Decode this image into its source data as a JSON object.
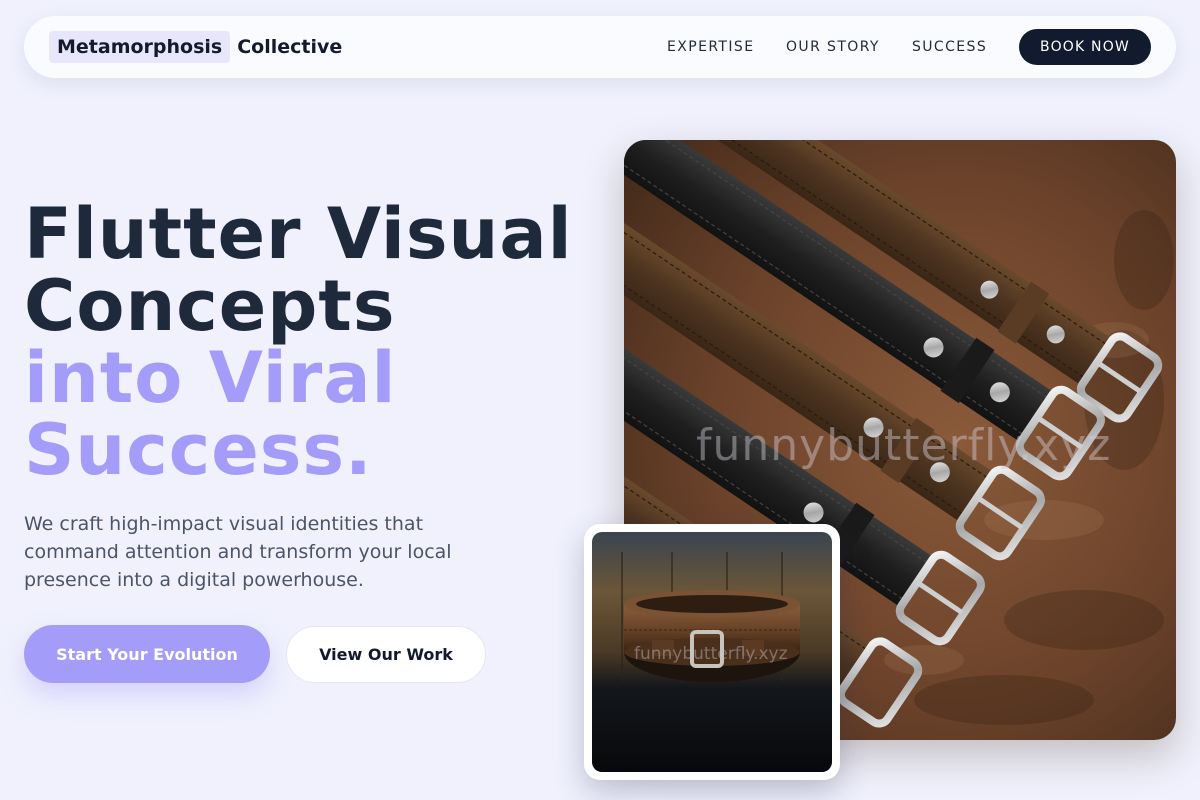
{
  "brand": {
    "highlight": "Metamorphosis",
    "rest": "Collective"
  },
  "nav": {
    "links": [
      "EXPERTISE",
      "OUR STORY",
      "SUCCESS"
    ],
    "cta": "BOOK NOW"
  },
  "hero": {
    "headline_dark": [
      "Flutter Visual",
      "Concepts"
    ],
    "headline_accent": [
      "into Viral",
      "Success."
    ],
    "description": "We craft high-impact visual identities that command attention and transform your local presence into a digital powerhouse.",
    "primary_button": "Start Your Evolution",
    "secondary_button": "View Our Work"
  },
  "images": {
    "main_watermark": "funnybutterfly.xyz",
    "small_watermark": "funnybutterfly.xyz"
  },
  "colors": {
    "background": "#f0f1fd",
    "accent": "#a49cf9",
    "dark": "#111a2e",
    "heading": "#1e293b"
  }
}
